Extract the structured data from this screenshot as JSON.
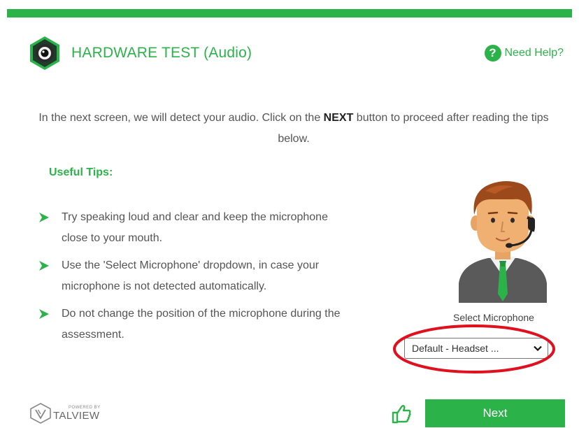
{
  "header": {
    "title": "HARDWARE TEST (Audio)",
    "logo_icon": "camera-lens-icon",
    "help_icon": "question-circle-icon",
    "help_label": "Need Help?"
  },
  "intro": {
    "text_before": "In the next screen, we will detect your audio. Click on the ",
    "text_bold": "NEXT",
    "text_after": " button to proceed after reading the tips below."
  },
  "tips": {
    "title": "Useful Tips:",
    "items": [
      "Try speaking loud and clear and keep the microphone close to your mouth.",
      "Use the 'Select Microphone' dropdown, in case your microphone is not detected automatically.",
      "Do not change the position of the microphone during the assessment."
    ]
  },
  "microphone": {
    "label": "Select Microphone",
    "selected": "Default - Headset ..."
  },
  "footer": {
    "powered_by": "POWERED BY",
    "brand": "TALVIEW",
    "next_label": "Next"
  },
  "colors": {
    "accent": "#2bb34a",
    "annotation": "#e0101e"
  }
}
